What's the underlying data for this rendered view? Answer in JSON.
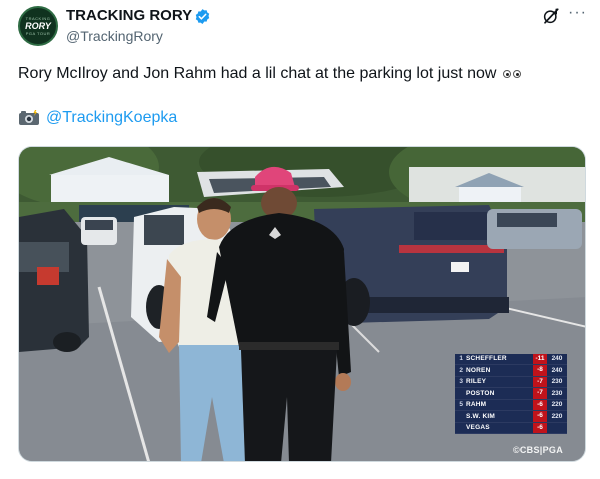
{
  "tweet": {
    "avatar": {
      "top_text": "TRACKING",
      "main_text": "RORY",
      "bottom_text": "PGA TOUR"
    },
    "display_name": "TRACKING RORY",
    "verified": true,
    "handle": "@TrackingRory",
    "text": "Rory McIlroy and Jon Rahm had a lil chat at the parking lot just now",
    "text_emoji": "eyes-emoji",
    "credit_icon": "camera-flash-icon",
    "credit_mention": "@TrackingKoepka"
  },
  "media": {
    "leaderboard": [
      {
        "pos": "1",
        "name": "SCHEFFLER",
        "score": "-11",
        "thru": "240"
      },
      {
        "pos": "2",
        "name": "NOREN",
        "score": "-8",
        "thru": "240"
      },
      {
        "pos": "3",
        "name": "RILEY",
        "score": "-7",
        "thru": "230"
      },
      {
        "pos": "",
        "name": "POSTON",
        "score": "-7",
        "thru": "230"
      },
      {
        "pos": "5",
        "name": "RAHM",
        "score": "-6",
        "thru": "220"
      },
      {
        "pos": "",
        "name": "S.W. KIM",
        "score": "-6",
        "thru": "220"
      },
      {
        "pos": "",
        "name": "VEGAS",
        "score": "-6",
        "thru": ""
      }
    ],
    "broadcast_bug": "©CBS|PGA"
  },
  "colors": {
    "link": "#1d9bf0",
    "verified_badge": "#1d9bf0",
    "score_red": "#c0131b",
    "leaderboard_bg": "#142450"
  }
}
